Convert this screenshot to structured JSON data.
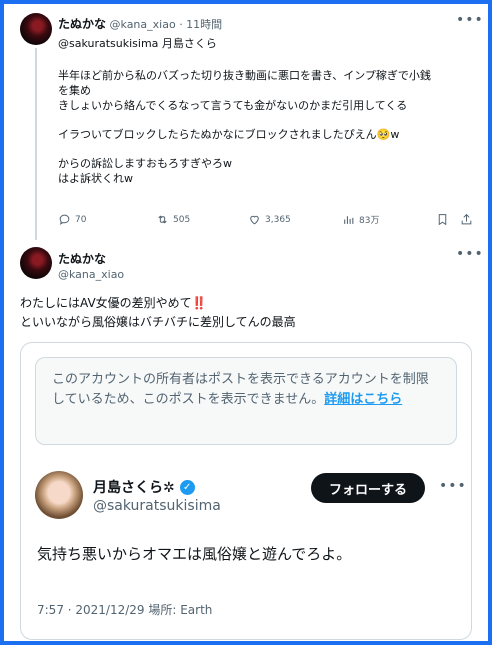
{
  "tweet1": {
    "display_name": "たぬかな",
    "handle": "@kana_xiao",
    "time": "· 11時間",
    "replying_to": "@sakuratsukisima 月島さくら",
    "lines": [
      "半年ほど前から私のバズった切り抜き動画に悪口を書き、インプ稼ぎで小銭",
      "を集め",
      "きしょいから絡んでくるなって言うても金がないのかまだ引用してくる",
      "",
      "イラついてブロックしたらたぬかなにブロックされましたぴえん🥺w",
      "",
      "からの訴訟しますおもろすぎやろw",
      "はよ訴状くれw"
    ],
    "stats": {
      "replies": "70",
      "reposts": "505",
      "likes": "3,365",
      "views": "83万"
    }
  },
  "tweet2": {
    "display_name": "たぬかな",
    "handle": "@kana_xiao",
    "line1": "わたしにはAV女優の差別やめて",
    "line1_emoji": "‼️",
    "line2": "といいながら風俗嬢はバチバチに差別してんの最高"
  },
  "quote": {
    "notice_text": "このアカウントの所有者はポストを表示できるアカウントを制限しているため、このポストを表示できません。",
    "notice_link": "詳細はこちら",
    "display_name": "月島さくら✲",
    "handle": "@sakuratsukisima",
    "follow_label": "フォローする",
    "text": "気持ち悪いからオマエは風俗嬢と遊んでろよ。",
    "meta": "7:57 · 2021/12/29 場所: Earth"
  },
  "icons": {
    "more": "more-icon",
    "reply": "reply-icon",
    "repost": "repost-icon",
    "like": "like-icon",
    "views": "views-icon",
    "bookmark": "bookmark-icon",
    "share": "share-icon",
    "verified": "verified-icon"
  },
  "colors": {
    "frame": "#1d6ff2",
    "link": "#1d9bf0",
    "follow_bg": "#0f1419"
  }
}
